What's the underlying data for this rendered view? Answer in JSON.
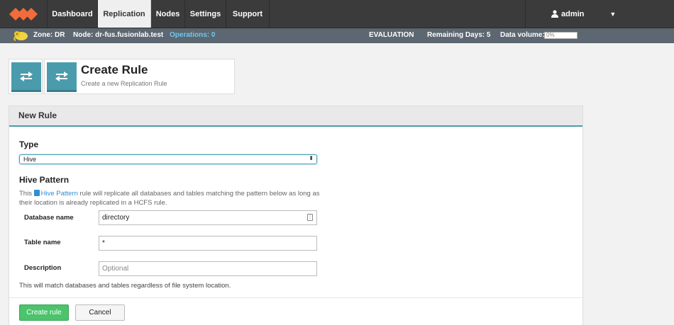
{
  "nav": {
    "tabs": [
      "Dashboard",
      "Replication",
      "Nodes",
      "Settings",
      "Support"
    ],
    "active_tab": "Replication",
    "user": "admin"
  },
  "status": {
    "zone": "Zone: DR",
    "node": "Node: dr-fus.fusionlab.test",
    "operations": "Operations: 0",
    "license": "EVALUATION",
    "remaining": "Remaining Days: 5",
    "data_volume_label": "Data volume:",
    "data_volume_value": "0%"
  },
  "header": {
    "title": "Create Rule",
    "subtitle": "Create a new Replication Rule"
  },
  "panel": {
    "title": "New Rule"
  },
  "form": {
    "type_label": "Type",
    "type_value": "Hive",
    "section_title": "Hive Pattern",
    "desc_pre": "This ",
    "desc_link": "Hive Pattern",
    "desc_post": " rule will replicate all databases and tables matching the pattern below as long as their location is already replicated in a HCFS rule.",
    "db_label": "Database name",
    "db_value": "directory",
    "table_label": "Table name",
    "table_value": "*",
    "description_label": "Description",
    "description_placeholder": "Optional",
    "note": "This will match databases and tables regardless of file system location."
  },
  "buttons": {
    "create": "Create rule",
    "cancel": "Cancel"
  },
  "colors": {
    "accent": "#4a9cad",
    "primary_button": "#4cc36c",
    "logo": "#f26b3a",
    "link": "#2d8fd5"
  }
}
